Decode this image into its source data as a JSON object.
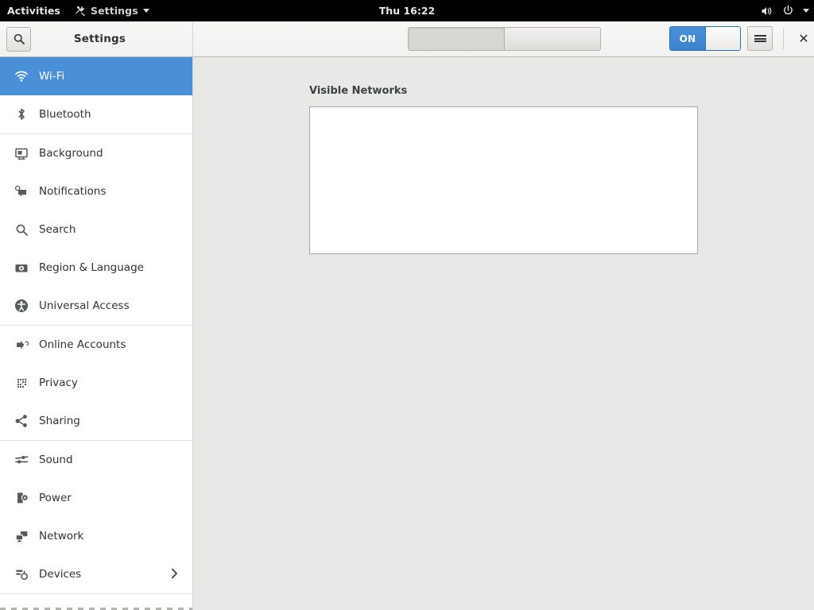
{
  "topbar": {
    "activities_label": "Activities",
    "app_menu_label": "Settings",
    "app_menu_icon": "settings-wrench-icon",
    "clock": "Thu 16:22",
    "volume_icon": "volume-speaker-icon",
    "power_icon": "power-icon",
    "menu_caret_icon": "caret-down-icon"
  },
  "headerbar": {
    "search_button_icon": "search-icon",
    "title": "Settings",
    "segmented": [
      {
        "name": "segment-left",
        "label": "",
        "active": true
      },
      {
        "name": "segment-right",
        "label": "",
        "active": false
      }
    ],
    "toggle": {
      "label": "ON",
      "state": "on",
      "accent_color": "#4a90d9"
    },
    "menu_button_icon": "hamburger-menu-icon",
    "close_button_icon": "close-x-icon",
    "close_button_label": "✕"
  },
  "sidebar": {
    "selected": "Wi-Fi",
    "selected_color": "#4a90d9",
    "items": [
      {
        "label": "Wi-Fi",
        "icon": "wifi-icon",
        "selected": true,
        "chevron": false,
        "sep_after": false
      },
      {
        "label": "Bluetooth",
        "icon": "bluetooth-icon",
        "selected": false,
        "chevron": false,
        "sep_after": true
      },
      {
        "label": "Background",
        "icon": "background-icon",
        "selected": false,
        "chevron": false,
        "sep_after": false
      },
      {
        "label": "Notifications",
        "icon": "notifications-icon",
        "selected": false,
        "chevron": false,
        "sep_after": false
      },
      {
        "label": "Search",
        "icon": "search-icon",
        "selected": false,
        "chevron": false,
        "sep_after": false
      },
      {
        "label": "Region & Language",
        "icon": "region-language-icon",
        "selected": false,
        "chevron": false,
        "sep_after": false
      },
      {
        "label": "Universal Access",
        "icon": "universal-access-icon",
        "selected": false,
        "chevron": false,
        "sep_after": true
      },
      {
        "label": "Online Accounts",
        "icon": "online-accounts-icon",
        "selected": false,
        "chevron": false,
        "sep_after": false
      },
      {
        "label": "Privacy",
        "icon": "privacy-icon",
        "selected": false,
        "chevron": false,
        "sep_after": false
      },
      {
        "label": "Sharing",
        "icon": "sharing-icon",
        "selected": false,
        "chevron": false,
        "sep_after": true
      },
      {
        "label": "Sound",
        "icon": "sound-icon",
        "selected": false,
        "chevron": false,
        "sep_after": false
      },
      {
        "label": "Power",
        "icon": "power-battery-icon",
        "selected": false,
        "chevron": false,
        "sep_after": false
      },
      {
        "label": "Network",
        "icon": "network-icon",
        "selected": false,
        "chevron": false,
        "sep_after": false
      },
      {
        "label": "Devices",
        "icon": "devices-icon",
        "selected": false,
        "chevron": true,
        "sep_after": true
      }
    ]
  },
  "content": {
    "networks_heading": "Visible Networks",
    "networks": []
  }
}
